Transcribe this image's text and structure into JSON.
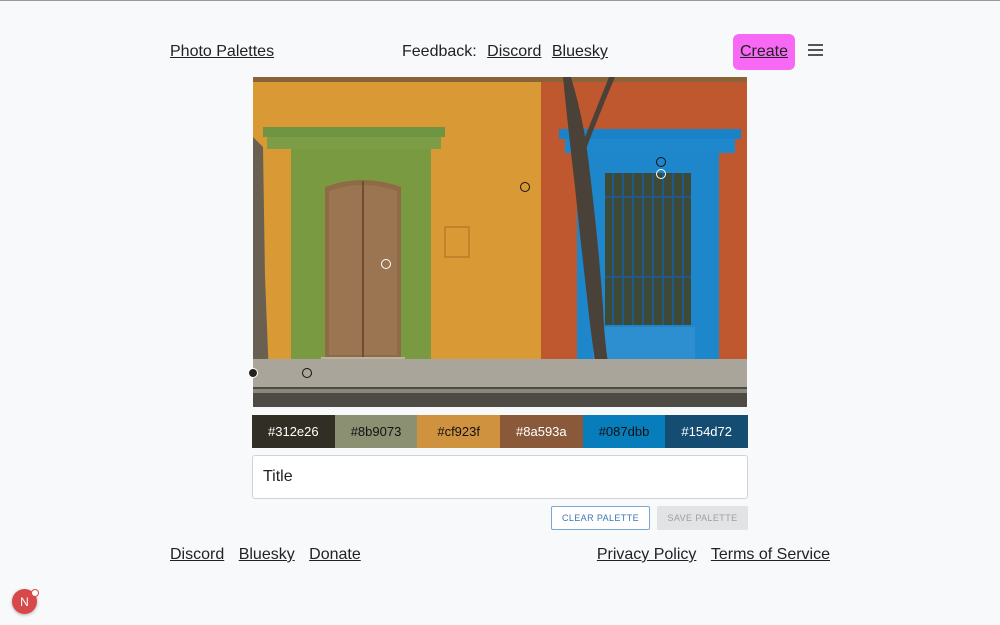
{
  "header": {
    "brand": "Photo Palettes",
    "feedback_label": "Feedback:",
    "discord": "Discord",
    "bluesky": "Bluesky",
    "create": "Create",
    "menu_icon": "hamburger-menu-icon"
  },
  "palette": {
    "swatches": [
      {
        "hex": "#312e26",
        "text_color": "#ffffff"
      },
      {
        "hex": "#8b9073",
        "text_color": "#111111"
      },
      {
        "hex": "#cf923f",
        "text_color": "#111111"
      },
      {
        "hex": "#8a593a",
        "text_color": "#ffffff"
      },
      {
        "hex": "#087dbb",
        "text_color": "#111111"
      },
      {
        "hex": "#154d72",
        "text_color": "#ffffff"
      }
    ]
  },
  "form": {
    "title_placeholder": "Title",
    "clear_label": "CLEAR PALETTE",
    "save_label": "SAVE PALETTE"
  },
  "footer": {
    "discord": "Discord",
    "bluesky": "Bluesky",
    "donate": "Donate",
    "privacy": "Privacy Policy",
    "terms": "Terms of Service"
  },
  "avatar": {
    "initial": "N",
    "color": "#d84848"
  }
}
